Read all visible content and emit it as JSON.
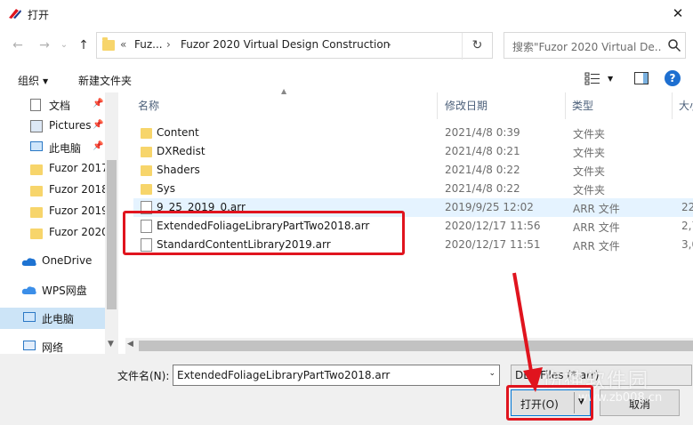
{
  "window": {
    "title": "打开",
    "close_glyph": "✕"
  },
  "nav": {
    "back": "←",
    "forward": "→",
    "dropdown": "⌄",
    "up": "↑",
    "refresh": "↻"
  },
  "address": {
    "overflow": "«",
    "parts": [
      "Fuz...",
      "Fuzor 2020 Virtual Design Construction"
    ],
    "sep": "›",
    "dropdown": "⌄"
  },
  "search": {
    "placeholder": "搜索\"Fuzor 2020 Virtual De..."
  },
  "toolbar": {
    "organize": "组织",
    "organize_caret": "▼",
    "new_folder": "新建文件夹",
    "view_caret": "▼",
    "help": "?"
  },
  "sidebar": {
    "items": [
      {
        "label": "文档",
        "pin": "📌"
      },
      {
        "label": "Pictures",
        "pin": "📌"
      },
      {
        "label": "此电脑",
        "pin": "📌"
      },
      {
        "label": "Fuzor 2017"
      },
      {
        "label": "Fuzor 2018"
      },
      {
        "label": "Fuzor 2019"
      },
      {
        "label": "Fuzor 2020"
      },
      {
        "label": "OneDrive"
      },
      {
        "label": "WPS网盘"
      },
      {
        "label": "此电脑"
      },
      {
        "label": "网络"
      }
    ]
  },
  "columns": {
    "name": "名称",
    "date": "修改日期",
    "type": "类型",
    "size": "大小"
  },
  "files": [
    {
      "name": "Content",
      "date": "2021/4/8 0:39",
      "type": "文件夹",
      "size": "",
      "kind": "folder"
    },
    {
      "name": "DXRedist",
      "date": "2021/4/8 0:21",
      "type": "文件夹",
      "size": "",
      "kind": "folder"
    },
    {
      "name": "Shaders",
      "date": "2021/4/8 0:22",
      "type": "文件夹",
      "size": "",
      "kind": "folder"
    },
    {
      "name": "Sys",
      "date": "2021/4/8 0:22",
      "type": "文件夹",
      "size": "",
      "kind": "folder"
    },
    {
      "name": "9_25_2019_0.arr",
      "date": "2019/9/25 12:02",
      "type": "ARR 文件",
      "size": "22",
      "kind": "file"
    },
    {
      "name": "ExtendedFoliageLibraryPartTwo2018.arr",
      "date": "2020/12/17 11:56",
      "type": "ARR 文件",
      "size": "2,7",
      "kind": "file"
    },
    {
      "name": "StandardContentLibrary2019.arr",
      "date": "2020/12/17 11:51",
      "type": "ARR 文件",
      "size": "3,0",
      "kind": "file"
    }
  ],
  "bottom": {
    "filename_label": "文件名(N):",
    "filename_value": "ExtendedFoliageLibraryPartTwo2018.arr",
    "filter_value": "DLC Files (*.arr)",
    "open_label": "打开(O)",
    "open_caret": "▼",
    "cancel_label": "取消",
    "watermark_cn": "伤神软件园",
    "watermark_url": "www.zb008.cn"
  },
  "colors": {
    "highlight": "#e0141e",
    "accent": "#0078d7",
    "folder": "#f7d56b",
    "selected": "#cce4f7"
  }
}
